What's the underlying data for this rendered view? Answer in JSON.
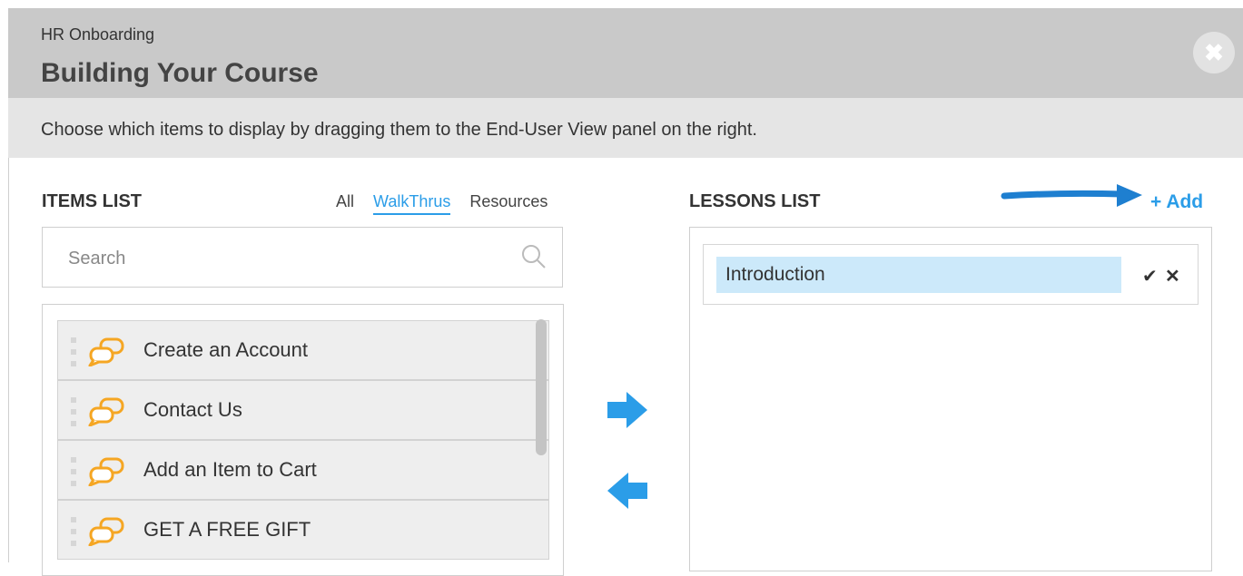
{
  "header": {
    "subtitle": "HR Onboarding",
    "title": "Building Your Course",
    "close_icon": "close-icon"
  },
  "instruction": "Choose which items to display by dragging them to the End-User View panel on the right.",
  "items_section": {
    "title": "ITEMS LIST",
    "filters": [
      "All",
      "WalkThrus",
      "Resources"
    ],
    "active_filter": "WalkThrus",
    "search": {
      "placeholder": "Search",
      "value": ""
    },
    "items": [
      {
        "label": "Create an Account",
        "icon": "walkthru-icon"
      },
      {
        "label": "Contact Us",
        "icon": "walkthru-icon"
      },
      {
        "label": "Add an Item to Cart",
        "icon": "walkthru-icon"
      },
      {
        "label": "GET A FREE GIFT",
        "icon": "walkthru-icon"
      }
    ]
  },
  "move_buttons": {
    "right_icon": "arrow-right-icon",
    "left_icon": "arrow-left-icon"
  },
  "lessons_section": {
    "title": "LESSONS LIST",
    "add_label": "+ Add",
    "lessons": [
      {
        "name": "Introduction",
        "confirm_icon": "check-icon",
        "delete_icon": "close-icon"
      }
    ]
  },
  "colors": {
    "accent": "#2b9de8",
    "header_bg": "#c9c9c9",
    "instruction_bg": "#e5e5e5",
    "walkthru_icon": "#f5a623",
    "lesson_input_bg": "#cce9fa"
  }
}
